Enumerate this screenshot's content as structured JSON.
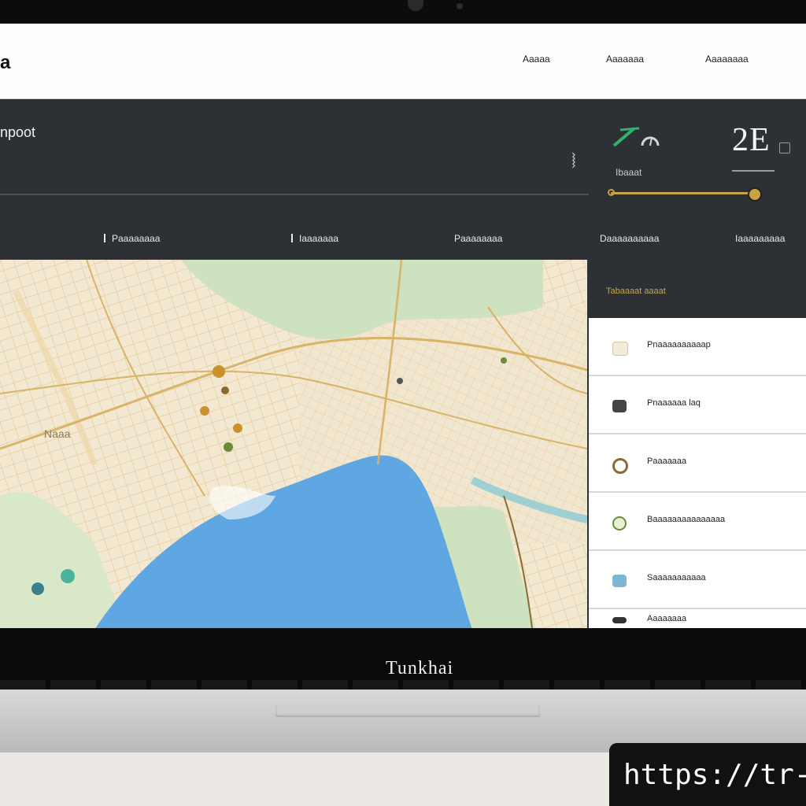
{
  "window": {
    "app_title": "a"
  },
  "nav": {
    "items": [
      "Aaaaa",
      "Aaaaaaa",
      "Aaaaaaaa"
    ]
  },
  "hero": {
    "title": "npoot",
    "gauge_caption": "Ibaaat",
    "stat_value": "2E",
    "slider_value": 0.95
  },
  "tabs": [
    {
      "label": "Paaaaaaaa"
    },
    {
      "label": "Iaaaaaaa"
    },
    {
      "label": "Paaaaaaaa"
    },
    {
      "label": "Daaaaaaaaaa"
    },
    {
      "label": "Iaaaaaaaaa"
    }
  ],
  "map": {
    "water_color": "#5fa7e2",
    "park_color": "#cfe2bf",
    "street_color": "#e6c27a",
    "labels": [
      "Naaa"
    ]
  },
  "results": {
    "header": "Tabaaaat aaaat",
    "items": [
      {
        "label": "Pnaaaaaaaaaap",
        "icon": "image-icon",
        "icon_color": "#f1ecd9"
      },
      {
        "label": "Pnaaaaaa laq",
        "icon": "monitor-icon",
        "icon_color": "#444444"
      },
      {
        "label": "Paaaaaaa",
        "icon": "target-icon",
        "icon_color": "#8a6a2e"
      },
      {
        "label": "Baaaaaaaaaaaaaaa",
        "icon": "globe-icon",
        "icon_color": "#6b8a3a"
      },
      {
        "label": "Saaaaaaaaaaa",
        "icon": "message-icon",
        "icon_color": "#7fb6d6"
      },
      {
        "label": "Aaaaaaaa",
        "icon": "file-icon",
        "icon_color": "#333333"
      }
    ]
  },
  "device": {
    "brand": "Tunkhai"
  },
  "watermark": {
    "text": "https://tr-so"
  },
  "colors": {
    "accent": "#caa244",
    "dark_panel": "#2d3034",
    "green_accent": "#2fb36b"
  }
}
